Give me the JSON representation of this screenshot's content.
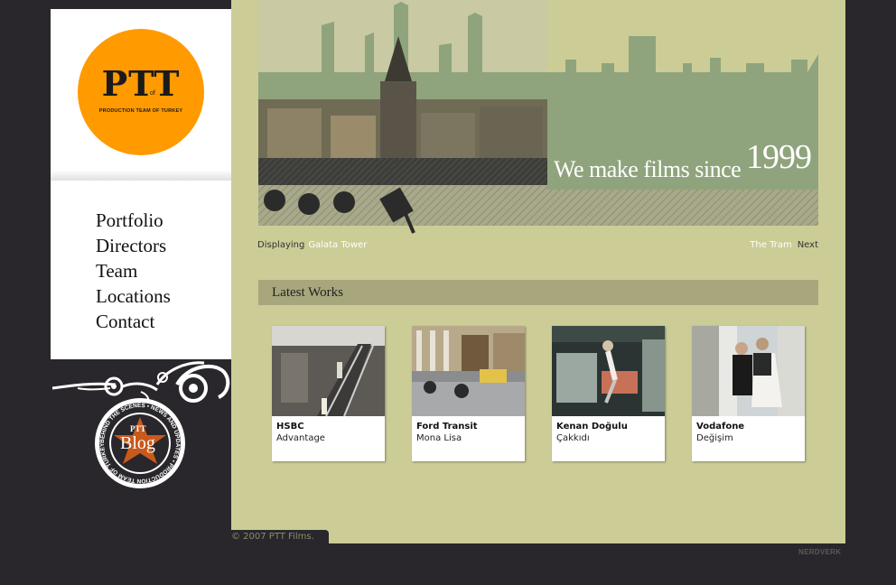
{
  "logo": {
    "main": "PTT",
    "of": "of",
    "subtitle": "PRODUCTION TEAM OF TURKEY"
  },
  "nav": {
    "items": [
      "Portfolio",
      "Directors",
      "Team",
      "Locations",
      "Contact"
    ]
  },
  "blog": {
    "top": "PTT",
    "main": "Blog",
    "ring_text": "BEHIND THE SCENES • NEWS AND UPDATES • PRODUCTION TEAM OF TURKEY •"
  },
  "banner": {
    "tagline": "We make films since",
    "year": "1999"
  },
  "caption": {
    "label": "Displaying",
    "value": "Galata Tower",
    "tram": "The Tram",
    "next": "Next"
  },
  "latest": {
    "title": "Latest Works",
    "works": [
      {
        "title": "HSBC",
        "subtitle": "Advantage"
      },
      {
        "title": "Ford Transit",
        "subtitle": "Mona Lisa"
      },
      {
        "title": "Kenan Doğulu",
        "subtitle": "Çakkıdı"
      },
      {
        "title": "Vodafone",
        "subtitle": "Değişim"
      }
    ]
  },
  "footer": {
    "copyright": "© 2007 PTT Films.",
    "credit": "NERDVERK"
  },
  "colors": {
    "background": "#29272b",
    "main": "#cccc96",
    "logo": "#ff9a00",
    "header_bar": "#a8a67c",
    "skyline": "#8fa47c"
  }
}
